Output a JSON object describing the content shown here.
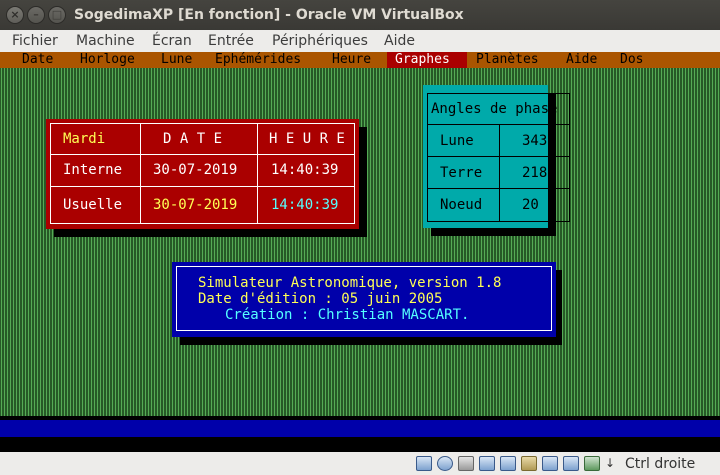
{
  "window": {
    "title": "SogedimaXP [En fonction] - Oracle VM VirtualBox",
    "close_glyph": "×",
    "minimize_glyph": "–",
    "maximize_glyph": "□"
  },
  "vbox_menu": [
    "Fichier",
    "Machine",
    "Écran",
    "Entrée",
    "Périphériques",
    "Aide"
  ],
  "dos_menu": {
    "items": [
      "Date",
      "Horloge",
      "Lune",
      "Ephémérides",
      "Heure",
      "Graphes",
      "Planètes",
      "Aide",
      "Dos"
    ],
    "selected": "Graphes"
  },
  "date_table": {
    "day": "Mardi",
    "header_date": "D A T E",
    "header_time": "H E U R E",
    "rows": [
      {
        "label": "Interne",
        "date": "30-07-2019",
        "time": "14:40:39"
      },
      {
        "label": "Usuelle",
        "date": "30-07-2019",
        "time": "14:40:39"
      }
    ]
  },
  "phase_table": {
    "title": "Angles de phase",
    "rows": [
      {
        "label": "Lune",
        "value": "343"
      },
      {
        "label": "Terre",
        "value": "218"
      },
      {
        "label": "Noeud",
        "value": "20"
      }
    ]
  },
  "info": {
    "line1": "Simulateur Astronomique, version 1.8",
    "line2": "Date d'édition : 05 juin 2005",
    "line3": "Création : Christian MASCART."
  },
  "status": {
    "host_key": "Ctrl droite",
    "icons": [
      "hard-disk-icon",
      "optical-drive-icon",
      "audio-icon",
      "network-icon",
      "usb-icon",
      "shared-folders-icon",
      "display-icon",
      "video-capture-icon",
      "virtualization-icon",
      "mouse-integration-icon",
      "keyboard-arrow-icon"
    ]
  },
  "colors": {
    "dos_menu_bg": "#aa5500",
    "dos_menu_selected": "#aa0000",
    "date_box": "#aa0000",
    "phase_box": "#00aaaa",
    "info_box": "#0000aa",
    "desktop_dots": "#55aa55"
  }
}
